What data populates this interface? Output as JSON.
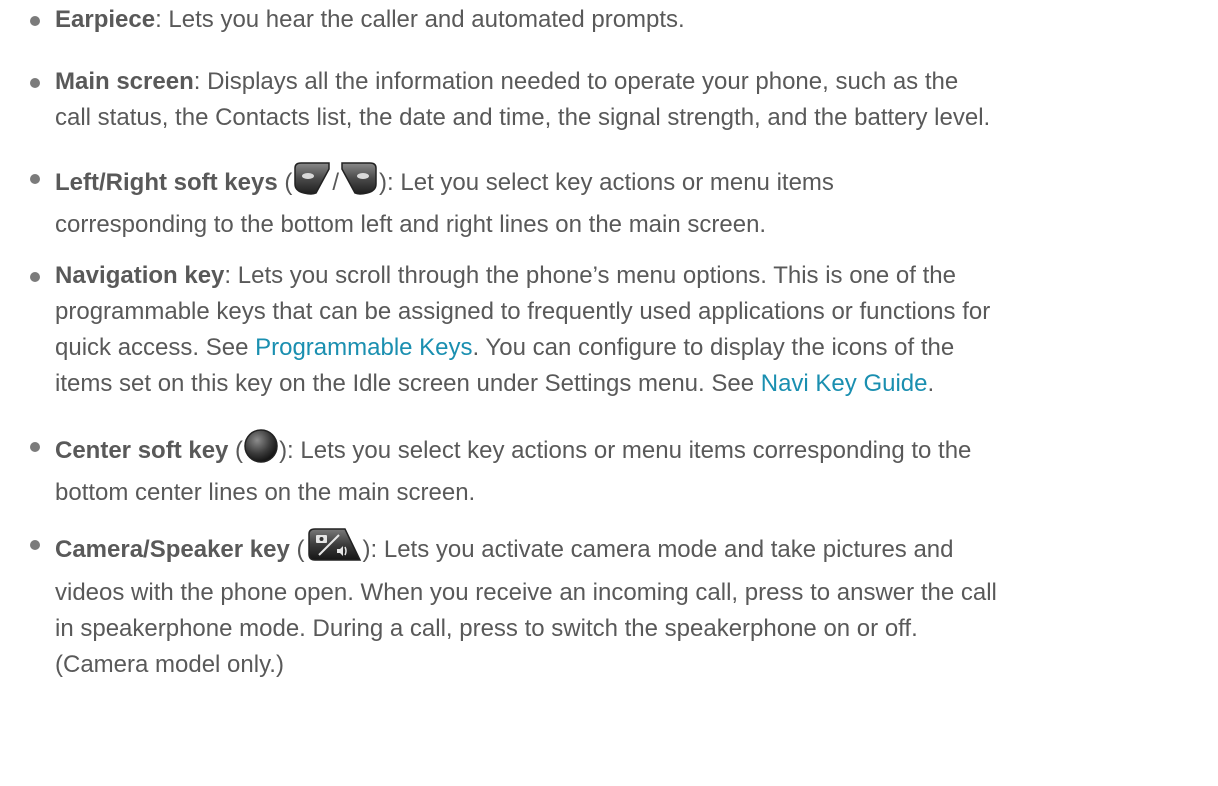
{
  "items": [
    {
      "term": "Earpiece",
      "text": ": Lets you hear the caller and automated prompts."
    },
    {
      "term": "Main screen",
      "line1": ": Displays all the information needed to operate your phone, such as the",
      "line2": "call status, the Contacts list, the date and time, the signal strength, and the battery level."
    },
    {
      "term": "Left/Right soft keys",
      "open": " (",
      "slash": "/",
      "close_text": "): Let you select key actions or menu items",
      "line2": "corresponding to the bottom left and right lines on the main screen.",
      "icons": [
        "left-soft-key-icon",
        "right-soft-key-icon"
      ]
    },
    {
      "term": "Navigation key",
      "line1": ": Lets you scroll through the phone’s menu options. This is one of the",
      "line2": "programmable keys that can be assigned to frequently used applications or functions for",
      "line3_a": "quick access. See ",
      "link1": "Programmable Keys",
      "line3_b": ". You can configure to display the icons of the",
      "line4_a": "items set on this key on the Idle screen under Settings menu. See ",
      "link2": "Navi Key Guide",
      "line4_b": "."
    },
    {
      "term": "Center soft key",
      "open": " (",
      "close_text": "): Lets you select key actions or menu items corresponding to the",
      "line2": "bottom center lines on the main screen.",
      "icons": [
        "center-soft-key-icon"
      ]
    },
    {
      "term": "Camera/Speaker key",
      "open": " (",
      "close_text": "): Lets you activate camera mode and take pictures and",
      "line2": "videos with the phone open. When you receive an incoming call, press to answer the call",
      "line3": "in speakerphone mode. During a call, press to switch the speakerphone on or off.",
      "line4": "(Camera model only.)",
      "icons": [
        "camera-speaker-key-icon"
      ]
    }
  ],
  "colors": {
    "text": "#595959",
    "link": "#1a8fb0",
    "bullet": "#7b7b7b"
  }
}
